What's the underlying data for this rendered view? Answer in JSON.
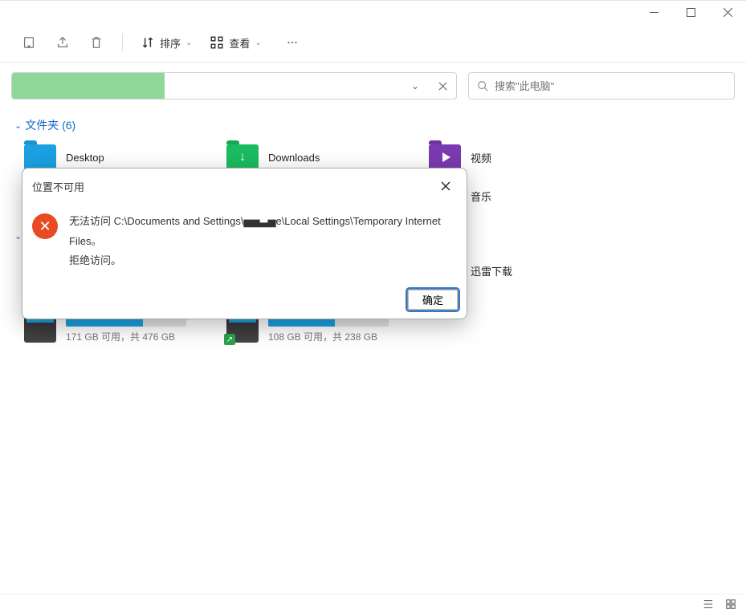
{
  "toolbar": {
    "sort_label": "排序",
    "view_label": "查看"
  },
  "search": {
    "placeholder": "搜索\"此电脑\""
  },
  "folders_section": {
    "title": "文件夹 (6)",
    "items": [
      {
        "label": "Desktop",
        "icon": "blue"
      },
      {
        "label": "Downloads",
        "icon": "green"
      },
      {
        "label": "视频",
        "icon": "purple"
      },
      {
        "label": "音乐",
        "icon": "yellow"
      },
      {
        "label": "迅雷下载",
        "icon": "bluep"
      }
    ]
  },
  "drives": [
    {
      "free_text": "171 GB 可用，共 476 GB",
      "fill_pct": 64
    },
    {
      "free_text": "108 GB 可用，共 238 GB",
      "fill_pct": 55,
      "shared": true
    }
  ],
  "dialog": {
    "title": "位置不可用",
    "line1": "无法访问 C:\\Documents and Settings\\▅▅▃▅e\\Local Settings\\Temporary Internet Files。",
    "line2": "拒绝访问。",
    "ok_label": "确定"
  }
}
